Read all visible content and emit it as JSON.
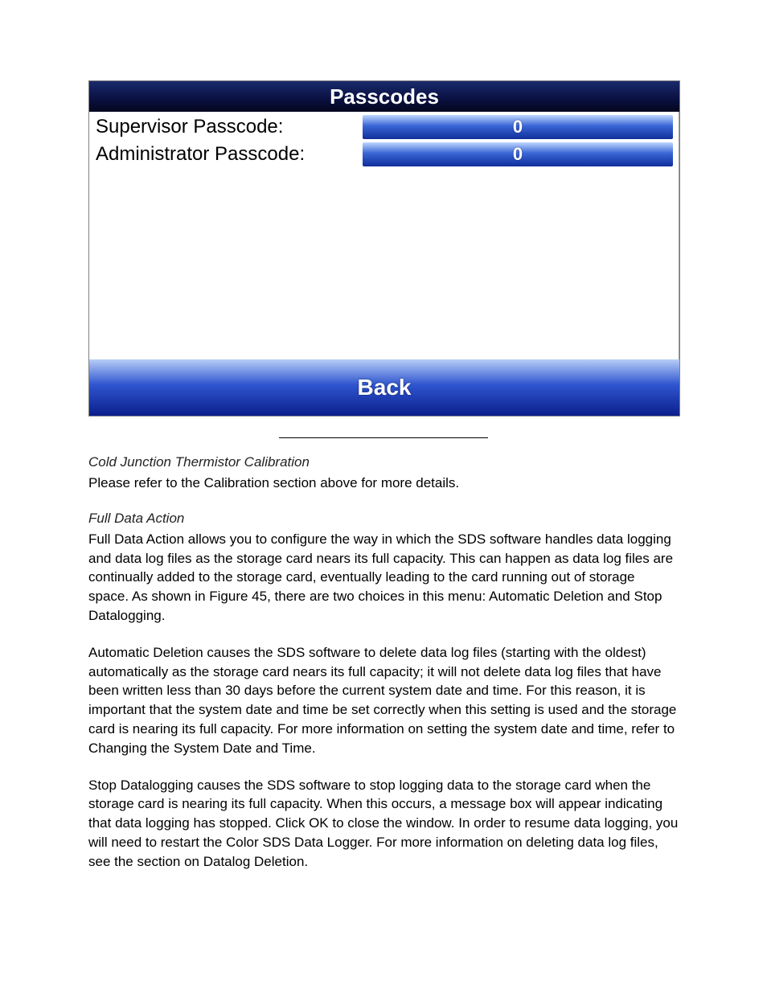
{
  "panel": {
    "title": "Passcodes",
    "rows": [
      {
        "label": "Supervisor Passcode:",
        "value": "0"
      },
      {
        "label": "Administrator Passcode:",
        "value": "0"
      }
    ],
    "back_label": "Back"
  },
  "sections": {
    "cj_heading": "Cold Junction Thermistor Calibration",
    "cj_text": "Please refer to the Calibration section above for more details.",
    "fda_heading": "Full Data Action",
    "fda_p1": "Full Data Action allows you to configure the way in which the SDS software handles data logging and data log files as the storage card nears its full capacity. This can happen as data log files are continually added to the storage card, eventually leading to the card running out of storage space. As shown in Figure 45, there are two choices in this menu: Automatic Deletion and Stop Datalogging.",
    "fda_p2": "Automatic Deletion causes the SDS software to delete data log files (starting with the oldest) automatically as the storage card nears its full capacity; it will not delete data log files that have been written less than 30 days before the current system date and time. For this reason, it is important that the system date and time be set correctly when this setting is used and the storage card is nearing its full capacity. For more information on setting the system date and time, refer to Changing the System Date and Time.",
    "fda_p3": "Stop Datalogging causes the SDS software to stop logging data to the storage card when the storage card is nearing its full capacity. When this occurs, a message box will appear indicating that data logging has stopped. Click OK to close the window. In order to resume data logging, you will need to restart the Color SDS Data Logger. For more information on deleting data log files, see the section on Datalog Deletion."
  }
}
